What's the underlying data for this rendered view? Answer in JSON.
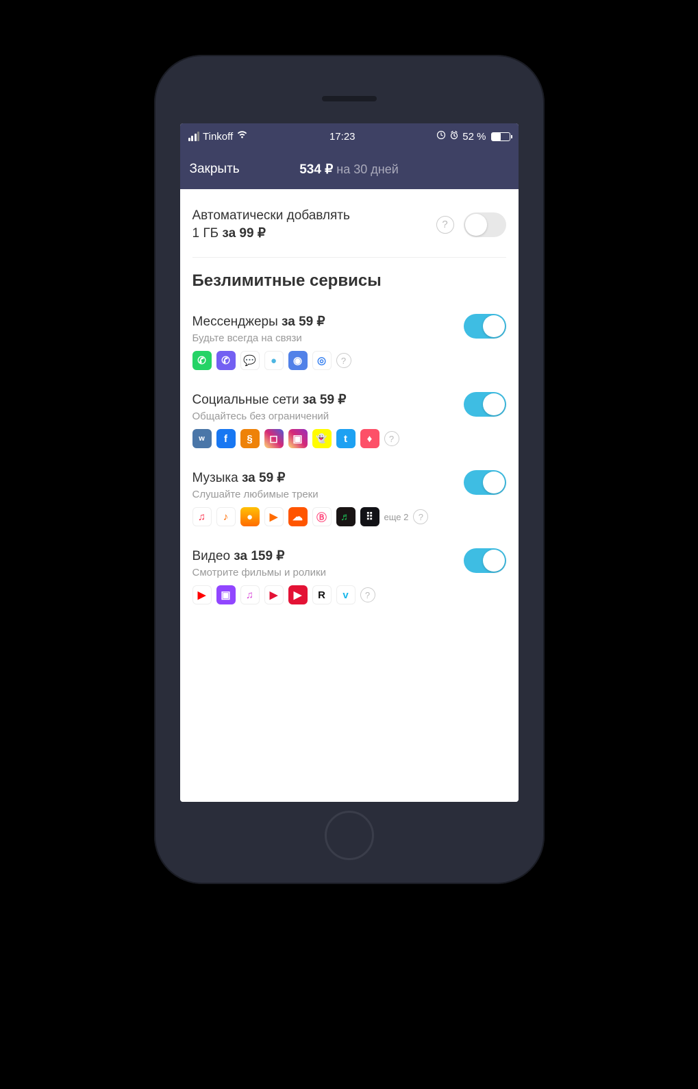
{
  "status": {
    "carrier": "Tinkoff",
    "time": "17:23",
    "battery_pct": "52 %"
  },
  "nav": {
    "close": "Закрыть",
    "price": "534 ₽",
    "period": "на 30 дней"
  },
  "auto_add": {
    "line1": "Автоматически добавлять",
    "line2_prefix": "1 ГБ ",
    "line2_bold": "за 99 ₽",
    "enabled": false
  },
  "section_title": "Безлимитные сервисы",
  "services": [
    {
      "title_plain": "Мессенджеры ",
      "title_bold": "за 59 ₽",
      "subtitle": "Будьте всегда на связи",
      "enabled": true,
      "more": "",
      "icons": [
        {
          "name": "whatsapp-icon",
          "bg": "#25d366",
          "glyph": "✆"
        },
        {
          "name": "viber-icon",
          "bg": "#7360f2",
          "glyph": "✆"
        },
        {
          "name": "messenger-icon",
          "bg": "#ffffff",
          "glyph": "💬",
          "fg": "#0084ff",
          "border": "1px solid #eee"
        },
        {
          "name": "tamtam-icon",
          "bg": "#ffffff",
          "glyph": "●",
          "fg": "#4db6e2",
          "border": "1px solid #eee"
        },
        {
          "name": "vk-messenger-icon",
          "bg": "#5181e8",
          "glyph": "◉"
        },
        {
          "name": "imo-icon",
          "bg": "#ffffff",
          "glyph": "◎",
          "fg": "#3a82f0",
          "border": "1px solid #eee"
        }
      ]
    },
    {
      "title_plain": "Социальные сети ",
      "title_bold": "за 59 ₽",
      "subtitle": "Общайтесь без ограничений",
      "enabled": true,
      "more": "",
      "icons": [
        {
          "name": "vk-icon",
          "bg": "#4a76a8",
          "glyph": "w",
          "fs": "11px"
        },
        {
          "name": "facebook-icon",
          "bg": "#1877f2",
          "glyph": "f"
        },
        {
          "name": "odnoklassniki-icon",
          "bg": "#ee8208",
          "glyph": "§"
        },
        {
          "name": "instagram-icon",
          "bg": "linear-gradient(45deg,#feda75,#d62976,#4f5bd5)",
          "glyph": "◻"
        },
        {
          "name": "igtv-icon",
          "bg": "linear-gradient(45deg,#feda75,#d62976,#962fbf)",
          "glyph": "▣"
        },
        {
          "name": "snapchat-icon",
          "bg": "#fffc00",
          "glyph": "👻",
          "fg": "#000",
          "fs": "13px"
        },
        {
          "name": "twitter-icon",
          "bg": "#1da1f2",
          "glyph": "t"
        },
        {
          "name": "tinder-icon",
          "bg": "#fd5068",
          "glyph": "♦"
        }
      ]
    },
    {
      "title_plain": "Музыка ",
      "title_bold": "за 59 ₽",
      "subtitle": "Слушайте любимые треки",
      "enabled": true,
      "more": "еще 2",
      "icons": [
        {
          "name": "apple-music-icon",
          "bg": "#ffffff",
          "glyph": "♫",
          "fg": "#fa2d48",
          "border": "1px solid #eee"
        },
        {
          "name": "yandex-music-icon",
          "bg": "#ffffff",
          "glyph": "♪",
          "fg": "#ff6b00",
          "border": "1px solid #eee"
        },
        {
          "name": "zaycev-icon",
          "bg": "linear-gradient(#ffc107,#ff6b00)",
          "glyph": "●"
        },
        {
          "name": "google-play-music-icon",
          "bg": "#ffffff",
          "glyph": "▶",
          "fg": "#ff6b00",
          "border": "1px solid #eee"
        },
        {
          "name": "soundcloud-icon",
          "bg": "#ff5500",
          "glyph": "☁"
        },
        {
          "name": "boom-icon",
          "bg": "#ffffff",
          "glyph": "Ⓑ",
          "fg": "#ff4a7d",
          "border": "1px solid #eee"
        },
        {
          "name": "spotify-icon",
          "bg": "#191414",
          "glyph": "♬",
          "fg": "#1db954"
        },
        {
          "name": "deezer-icon",
          "bg": "#121216",
          "glyph": "⠿",
          "fg": "#fff"
        }
      ]
    },
    {
      "title_plain": "Видео ",
      "title_bold": "за 159 ₽",
      "subtitle": "Смотрите фильмы и ролики",
      "enabled": true,
      "more": "",
      "icons": [
        {
          "name": "youtube-icon",
          "bg": "#ffffff",
          "glyph": "▶",
          "fg": "#ff0000",
          "border": "1px solid #eee"
        },
        {
          "name": "twitch-icon",
          "bg": "#9146ff",
          "glyph": "▣"
        },
        {
          "name": "itunes-icon",
          "bg": "#ffffff",
          "glyph": "♫",
          "fg": "#d948d9",
          "border": "1px solid #eee"
        },
        {
          "name": "rutube-play-icon",
          "bg": "#ffffff",
          "glyph": "▶",
          "fg": "#e31235",
          "border": "1px solid #eee"
        },
        {
          "name": "youtube-kids-icon",
          "bg": "#e31235",
          "glyph": "▶"
        },
        {
          "name": "rutube-icon",
          "bg": "#ffffff",
          "glyph": "R",
          "fg": "#111",
          "border": "1px solid #eee"
        },
        {
          "name": "vimeo-icon",
          "bg": "#ffffff",
          "glyph": "v",
          "fg": "#1ab7ea",
          "border": "1px solid #eee"
        }
      ]
    }
  ]
}
